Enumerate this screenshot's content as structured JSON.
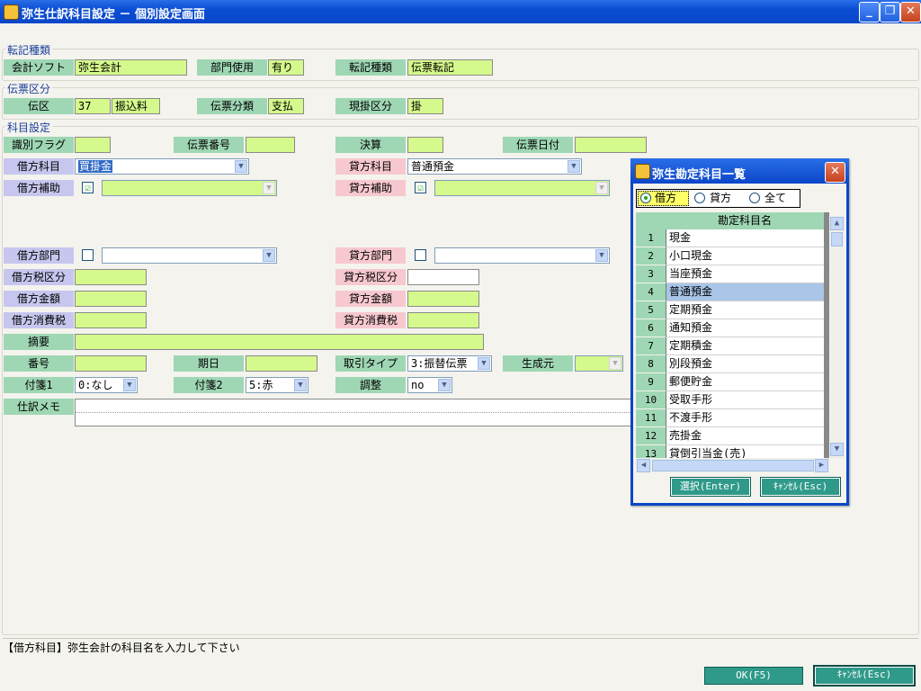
{
  "window": {
    "title": "弥生仕訳科目設定 － 個別設定画面"
  },
  "groups": {
    "tenki": {
      "legend": "転記種類",
      "kaikei_soft_label": "会計ソフト",
      "kaikei_soft_value": "弥生会計",
      "bumon_label": "部門使用",
      "bumon_value": "有り",
      "tenki_label": "転記種類",
      "tenki_value": "伝票転記"
    },
    "denpyo": {
      "legend": "伝票区分",
      "denku_label": "伝区",
      "denku_code": "37",
      "denku_name": "振込料",
      "bunrui_label": "伝票分類",
      "bunrui_value": "支払",
      "genkake_label": "現掛区分",
      "genkake_value": "掛"
    },
    "kamoku": {
      "legend": "科目設定",
      "shikibetsu_label": "識別フラグ",
      "shikibetsu_value": "",
      "denpyo_no_label": "伝票番号",
      "denpyo_no_value": "",
      "kessan_label": "決算",
      "kessan_value": "",
      "denpyo_date_label": "伝票日付",
      "denpyo_date_value": "",
      "kari_kamoku_label": "借方科目",
      "kari_kamoku_value": "買掛金",
      "kashi_kamoku_label": "貸方科目",
      "kashi_kamoku_value": "普通預金",
      "kari_hojo_label": "借方補助",
      "kari_hojo_checked": "☑",
      "kashi_hojo_label": "貸方補助",
      "kashi_hojo_checked": "☑",
      "kari_bumon_label": "借方部門",
      "kashi_bumon_label": "貸方部門",
      "kari_zei_label": "借方税区分",
      "kashi_zei_label": "貸方税区分",
      "kari_kingaku_label": "借方金額",
      "kashi_kingaku_label": "貸方金額",
      "kari_shohizei_label": "借方消費税",
      "kashi_shohizei_label": "貸方消費税",
      "tekiyo_label": "摘要",
      "bango_label": "番号",
      "kijitsu_label": "期日",
      "torihiki_label": "取引タイプ",
      "torihiki_value": "3:振替伝票",
      "seiseimoto_label": "生成元",
      "fusen1_label": "付箋1",
      "fusen1_value": "0:なし",
      "fusen2_label": "付箋2",
      "fusen2_value": "5:赤",
      "chosei_label": "調整",
      "chosei_value": "no",
      "memo_label": "仕訳メモ"
    }
  },
  "status_message": "【借方科目】弥生会計の科目名を入力して下さい",
  "buttons": {
    "ok": "OK(F5)",
    "cancel": "ｷｬﾝｾﾙ(Esc)"
  },
  "popup": {
    "title": "弥生勘定科目一覧",
    "radio_options": [
      "借方",
      "貸方",
      "全て"
    ],
    "selected_radio": "借方",
    "column_header": "勘定科目名",
    "rows": [
      {
        "no": "1",
        "name": "現金"
      },
      {
        "no": "2",
        "name": "小口現金"
      },
      {
        "no": "3",
        "name": "当座預金"
      },
      {
        "no": "4",
        "name": "普通預金"
      },
      {
        "no": "5",
        "name": "定期預金"
      },
      {
        "no": "6",
        "name": "通知預金"
      },
      {
        "no": "7",
        "name": "定期積金"
      },
      {
        "no": "8",
        "name": "別段預金"
      },
      {
        "no": "9",
        "name": "郵便貯金"
      },
      {
        "no": "10",
        "name": "受取手形"
      },
      {
        "no": "11",
        "name": "不渡手形"
      },
      {
        "no": "12",
        "name": "売掛金"
      },
      {
        "no": "13",
        "name": "貸倒引当金(売)"
      }
    ],
    "highlighted_row": "4",
    "select_button": "選択(Enter)",
    "cancel_button": "ｷｬﾝｾﾙ(Esc)"
  }
}
